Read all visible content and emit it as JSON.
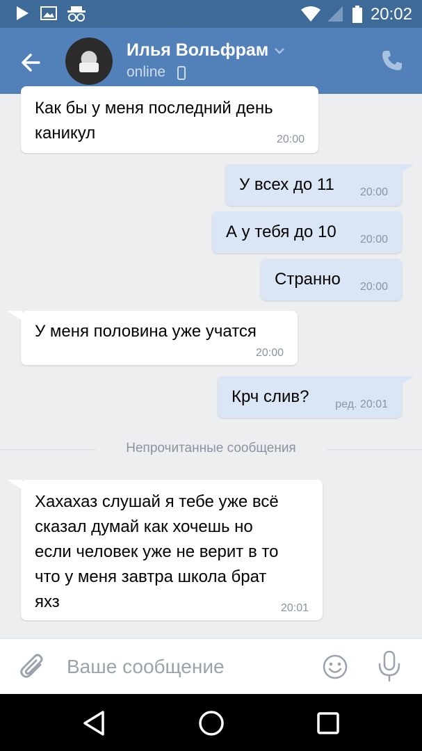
{
  "status_bar": {
    "time": "20:02",
    "icons": [
      "play-icon",
      "image-icon",
      "incognito-icon",
      "wifi-icon",
      "signal-icon",
      "battery-icon"
    ]
  },
  "header": {
    "contact_name": "Илья Вольфрам",
    "status": "online",
    "icons": [
      "back-arrow-icon",
      "chevron-down-icon",
      "mobile-icon",
      "phone-icon"
    ],
    "colors": {
      "header_bg": "#5181b8",
      "status_bar_bg": "#3d6a99"
    }
  },
  "messages": [
    {
      "direction": "in",
      "text": "Как бы у меня последний день\nканикул",
      "time": "20:00"
    },
    {
      "direction": "out",
      "text": "У всех до 11",
      "time": "20:00"
    },
    {
      "direction": "out",
      "text": "А у тебя до 10",
      "time": "20:00"
    },
    {
      "direction": "out",
      "text": "Странно",
      "time": "20:00"
    },
    {
      "direction": "in",
      "text": "У меня половина уже учатся",
      "time": "20:00"
    },
    {
      "direction": "out",
      "text": "Крч слив?",
      "time": "ред. 20:01"
    },
    {
      "direction": "in",
      "text": "Хахахаз слушай я тебе уже всё\nсказал думай как хочешь но\nесли человек уже не верит в то\nчто у меня завтра школа брат\nяхз",
      "time": "20:01"
    }
  ],
  "unread_divider": "Непрочитанные сообщения",
  "input": {
    "placeholder": "Ваше сообщение",
    "icons": [
      "paperclip-icon",
      "emoji-icon",
      "microphone-icon"
    ]
  },
  "nav_bar": {
    "icons": [
      "nav-back-icon",
      "nav-home-icon",
      "nav-recents-icon"
    ]
  },
  "colors": {
    "incoming_bubble": "#ffffff",
    "outgoing_bubble": "#dae6f5",
    "chat_bg": "#edeef0"
  }
}
